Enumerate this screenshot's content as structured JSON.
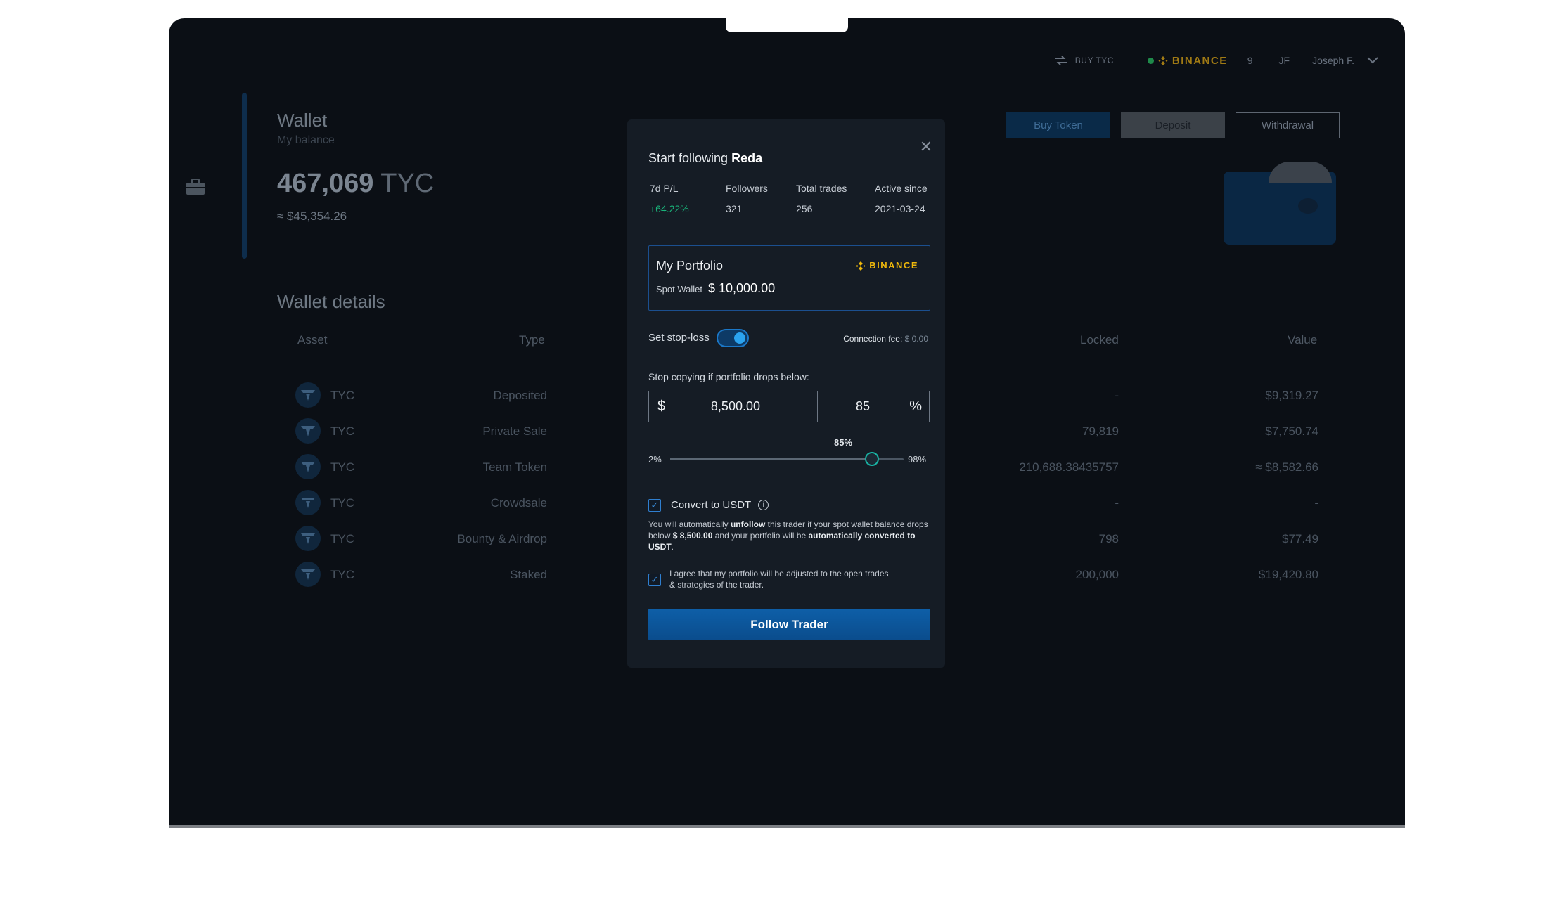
{
  "topbar": {
    "buy_label": "BUY TYC",
    "exchange": "BINANCE",
    "notifications": "9",
    "initials": "JF",
    "user": "Joseph F."
  },
  "wallet": {
    "title": "Wallet",
    "subtitle": "My balance",
    "balance_value": "467,069",
    "balance_unit": "TYC",
    "usd": "≈ $45,354.26",
    "buttons": [
      "Buy Token",
      "Deposit",
      "Withdrawal"
    ]
  },
  "details": {
    "title": "Wallet details",
    "headers": {
      "asset": "Asset",
      "type": "Type",
      "locked": "Locked",
      "value": "Value"
    },
    "rows": [
      {
        "asset": "TYC",
        "type": "Deposited",
        "locked": "-",
        "value": "$9,319.27"
      },
      {
        "asset": "TYC",
        "type": "Private Sale",
        "locked": "79,819",
        "value": "$7,750.74"
      },
      {
        "asset": "TYC",
        "type": "Team Token",
        "locked": "210,688.38435757",
        "value": "≈ $8,582.66"
      },
      {
        "asset": "TYC",
        "type": "Crowdsale",
        "locked": "-",
        "value": "-"
      },
      {
        "asset": "TYC",
        "type": "Bounty & Airdrop",
        "locked": "798",
        "value": "$77.49"
      },
      {
        "asset": "TYC",
        "type": "Staked",
        "locked": "200,000",
        "value": "$19,420.80"
      }
    ]
  },
  "modal": {
    "title_prefix": "Start following",
    "trader": "Reda",
    "stats": [
      {
        "label": "7d P/L",
        "value": "+64.22%"
      },
      {
        "label": "Followers",
        "value": "321"
      },
      {
        "label": "Total trades",
        "value": "256"
      },
      {
        "label": "Active since",
        "value": "2021-03-24"
      }
    ],
    "portfolio_title": "My Portfolio",
    "portfolio_exchange": "BINANCE",
    "spot_label": "Spot Wallet",
    "spot_amount": "$ 10,000.00",
    "stoploss_label": "Set stop-loss",
    "stoploss_on": true,
    "fee_label": "Connection fee:",
    "fee_value": "$ 0.00",
    "drop_label": "Stop copying if portfolio drops below:",
    "usd_symbol": "$",
    "usd_value": "8,500.00",
    "pct_value": "85",
    "pct_symbol": "%",
    "slider_label": "85%",
    "slider_min": "2%",
    "slider_max": "98%",
    "slider_value": 85,
    "slider_range": [
      2,
      98
    ],
    "convert_label": "Convert  to USDT",
    "note_1": "You will automatically ",
    "note_unfollow": "unfollow",
    "note_2": " this trader if your spot wallet balance drops below ",
    "note_amount": "$ 8,500.00",
    "note_3": " and your portfolio will be ",
    "note_converted": "automatically converted to USDT",
    "note_4": ".",
    "agree_text": "I agree that my portfolio will be adjusted to the open trades & strategies of the trader.",
    "follow_button": "Follow Trader"
  }
}
